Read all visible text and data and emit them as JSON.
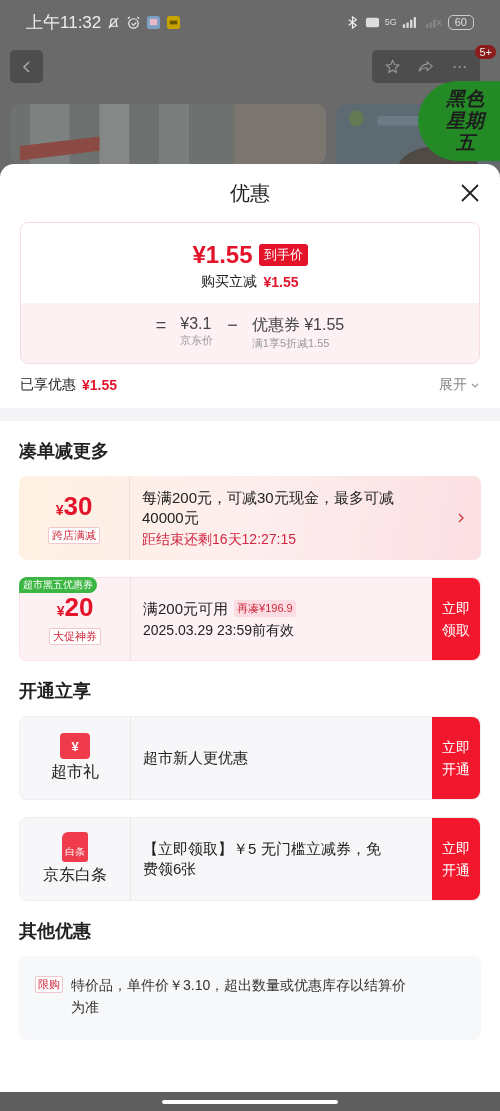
{
  "status_bar": {
    "time": "上午11:32",
    "network": "5G",
    "battery": "60"
  },
  "top_nav": {
    "badge": "5+",
    "promo_badge": "黑色星期五"
  },
  "sheet": {
    "title": "优惠",
    "summary": {
      "price": "¥1.55",
      "price_tag": "到手价",
      "instant_label": "购买立减",
      "instant_value": "¥1.55",
      "formula": [
        {
          "kind": "operator",
          "text": "="
        },
        {
          "kind": "term",
          "value": "¥3.1",
          "caption": "京东价"
        },
        {
          "kind": "operator",
          "text": "−"
        },
        {
          "kind": "term",
          "value": "优惠券 ¥1.55",
          "caption": "满1享5折减1.55"
        }
      ]
    },
    "enjoyed": {
      "label": "已享优惠",
      "value": "¥1.55",
      "toggle": "展开",
      "expanded": false
    },
    "sections": [
      {
        "title": "凑单减更多",
        "cards": [
          {
            "kind": "promo",
            "amount_currency": "¥",
            "amount": "30",
            "tag": "跨店满减",
            "text": "每满200元，可减30元现金，最多可减40000元",
            "note": "距结束还剩16天12:27:15"
          },
          {
            "kind": "coupon",
            "corner_tag": "超市黑五优惠券",
            "amount_currency": "¥",
            "amount": "20",
            "tag": "大促神券",
            "text": "满200元可用",
            "chip": "再凑¥196.9",
            "note": "2025.03.29 23:59前有效",
            "action": "立即领取"
          }
        ]
      },
      {
        "title": "开通立享",
        "cards": [
          {
            "kind": "service",
            "icon_glyph": "¥",
            "name": "超市礼",
            "text": "超市新人更优惠",
            "action": "立即开通"
          },
          {
            "kind": "service",
            "icon_glyph": "白条",
            "name": "京东白条",
            "text": "【立即领取】￥5 无门槛立减券，免费领6张",
            "action": "立即开通"
          }
        ]
      },
      {
        "title": "其他优惠",
        "cards": [
          {
            "kind": "rule",
            "tag": "限购",
            "text": "特价品，单件价￥3.10，超出数量或优惠库存以结算价为准"
          }
        ]
      }
    ]
  }
}
